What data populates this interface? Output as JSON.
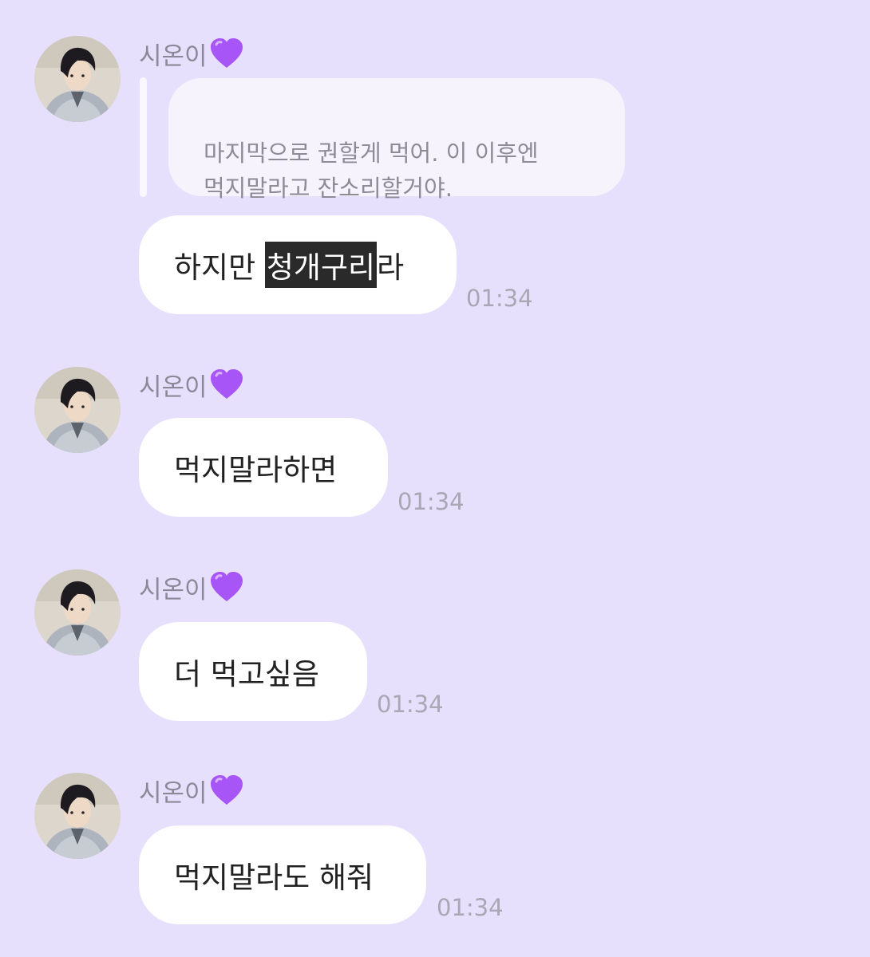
{
  "sender_name": "시온이",
  "avatar_icon": "profile-photo-avatar",
  "heart_icon": "purple-heart-icon",
  "colors": {
    "background": "#e7e0fd",
    "bubble": "#ffffff",
    "heart": "#a855f7",
    "highlight": "#2a2a2a"
  },
  "messages": [
    {
      "reply": "마지막으로 권할게 먹어. 이 이후엔\n먹지말라고 잔소리할거야.",
      "text_before": "하지만 ",
      "text_highlight": "청개구리",
      "text_after": "라",
      "time": "01:34"
    },
    {
      "text": "먹지말라하면",
      "time": "01:34"
    },
    {
      "text": "더 먹고싶음",
      "time": "01:34"
    },
    {
      "text": "먹지말라도 해줘",
      "time": "01:34"
    }
  ]
}
